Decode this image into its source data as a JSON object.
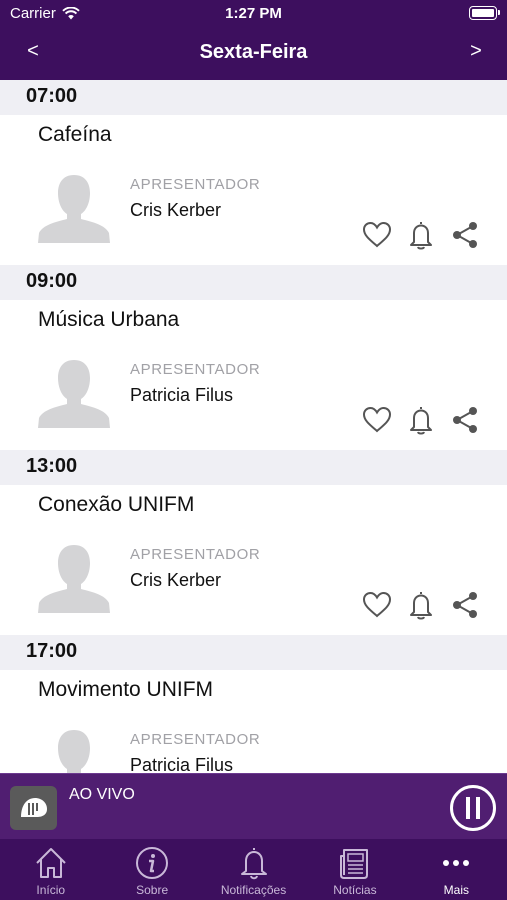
{
  "status_bar": {
    "carrier": "Carrier",
    "time": "1:27 PM"
  },
  "navbar": {
    "title": "Sexta-Feira",
    "prev_label": "<",
    "next_label": ">"
  },
  "schedule": [
    {
      "time": "07:00",
      "title": "Cafeína",
      "role": "APRESENTADOR",
      "host": "Cris Kerber"
    },
    {
      "time": "09:00",
      "title": "Música Urbana",
      "role": "APRESENTADOR",
      "host": "Patricia Filus"
    },
    {
      "time": "13:00",
      "title": "Conexão UNIFM",
      "role": "APRESENTADOR",
      "host": "Cris Kerber"
    },
    {
      "time": "17:00",
      "title": "Movimento UNIFM",
      "role": "APRESENTADOR",
      "host": "Patricia Filus"
    }
  ],
  "player": {
    "live_label": "AO VIVO"
  },
  "tabs": [
    {
      "label": "Início",
      "icon": "home-icon"
    },
    {
      "label": "Sobre",
      "icon": "info-icon"
    },
    {
      "label": "Notificações",
      "icon": "bell-icon"
    },
    {
      "label": "Notícias",
      "icon": "newspaper-icon"
    },
    {
      "label": "Mais",
      "icon": "more-icon",
      "active": true
    }
  ],
  "colors": {
    "primary": "#3d0f5e",
    "player": "#4a176c",
    "section_bg": "#efeff4",
    "muted": "#a1a1a6"
  }
}
